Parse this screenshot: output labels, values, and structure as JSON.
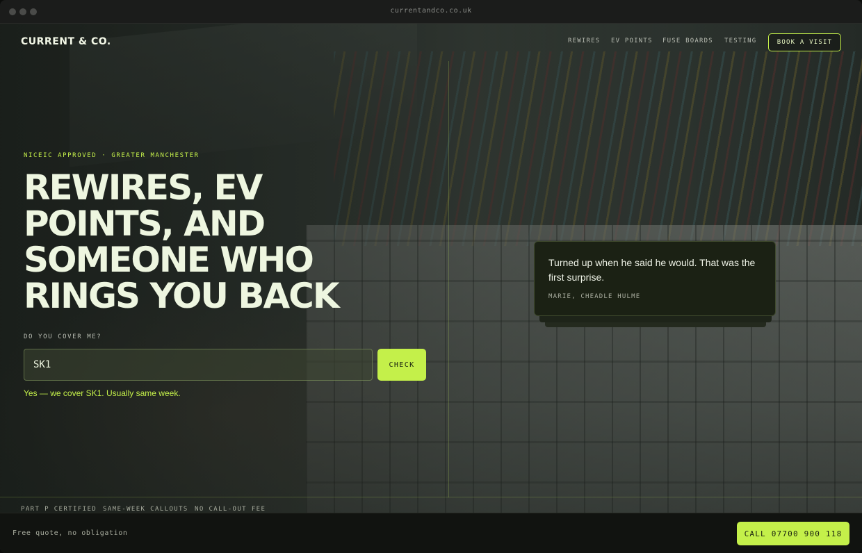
{
  "browser": {
    "url": "currentandco.co.uk"
  },
  "header": {
    "logo": "CURRENT & CO.",
    "nav": [
      "REWIRES",
      "EV POINTS",
      "FUSE BOARDS",
      "TESTING"
    ],
    "cta": "BOOK A VISIT"
  },
  "hero": {
    "eyebrow": "NICEIC APPROVED · GREATER MANCHESTER",
    "headline_lines": [
      "REWIRES, EV",
      "POINTS, AND",
      "SOMEONE WHO",
      "RINGS YOU BACK"
    ],
    "postcode_label": "DO YOU COVER ME?",
    "postcode_value": "SK1",
    "check_label": "CHECK",
    "result": "Yes — we cover SK1. Usually same week."
  },
  "testimonial": {
    "quote": "Turned up when he said he would. That was the first surprise.",
    "author": "MARIE, CHEADLE HULME"
  },
  "trust": [
    "PART P CERTIFIED",
    "SAME-WEEK CALLOUTS",
    "NO CALL-OUT FEE"
  ],
  "bottom_bar": {
    "text": "Free quote, no obligation",
    "call_label": "CALL 07700 900 118"
  },
  "colors": {
    "accent": "#c4f04a",
    "text": "#eef6e0",
    "bar": "#111310"
  }
}
